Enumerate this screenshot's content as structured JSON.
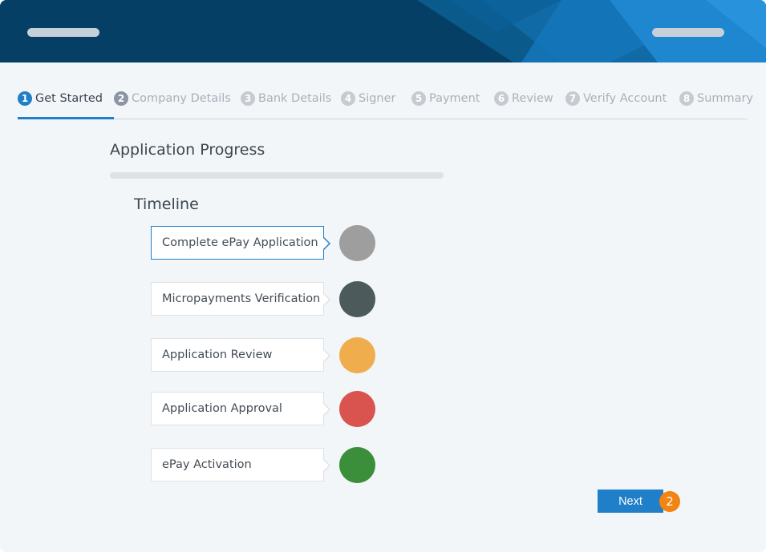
{
  "colors": {
    "header_dark": "#053f66",
    "header_accent": "#1f7fc9",
    "background": "#f3f6f9",
    "active_step": "#1f7fc9",
    "badge": "#f28411"
  },
  "steps": [
    {
      "num": "1",
      "label": "Get Started"
    },
    {
      "num": "2",
      "label": "Company Details"
    },
    {
      "num": "3",
      "label": "Bank Details"
    },
    {
      "num": "4",
      "label": "Signer"
    },
    {
      "num": "5",
      "label": "Payment"
    },
    {
      "num": "6",
      "label": "Review"
    },
    {
      "num": "7",
      "label": "Verify Account"
    },
    {
      "num": "8",
      "label": "Summary"
    }
  ],
  "progress": {
    "title": "Application Progress",
    "value": 0
  },
  "timeline": {
    "title": "Timeline",
    "items": [
      {
        "label": "Complete ePay Application",
        "color": "#9e9e9e"
      },
      {
        "label": "Micropayments Verification",
        "color": "#4d5a5c"
      },
      {
        "label": "Application Review",
        "color": "#f0ad4e"
      },
      {
        "label": "Application Approval",
        "color": "#d9534f"
      },
      {
        "label": "ePay Activation",
        "color": "#3b8f3b"
      }
    ]
  },
  "actions": {
    "next_label": "Next",
    "badge": "2"
  }
}
